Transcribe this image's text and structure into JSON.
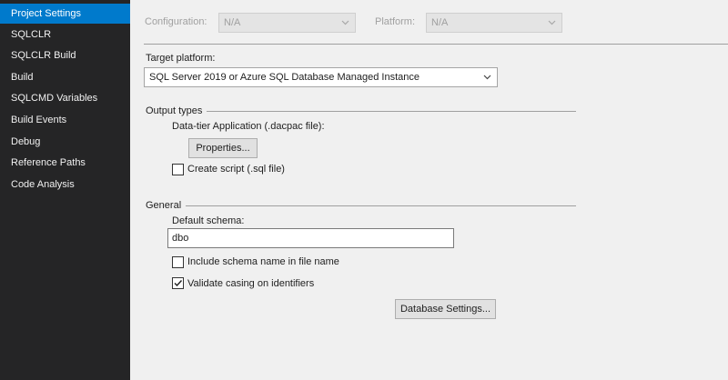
{
  "sidebar": {
    "items": [
      {
        "label": "Project Settings",
        "selected": true
      },
      {
        "label": "SQLCLR"
      },
      {
        "label": "SQLCLR Build"
      },
      {
        "label": "Build"
      },
      {
        "label": "SQLCMD Variables"
      },
      {
        "label": "Build Events"
      },
      {
        "label": "Debug"
      },
      {
        "label": "Reference Paths"
      },
      {
        "label": "Code Analysis"
      }
    ]
  },
  "toolbar": {
    "configuration_label": "Configuration:",
    "configuration_value": "N/A",
    "platform_label": "Platform:",
    "platform_value": "N/A"
  },
  "target_platform": {
    "label": "Target platform:",
    "value": "SQL Server 2019 or Azure SQL Database Managed Instance"
  },
  "output_types": {
    "header": "Output types",
    "dacpac_label": "Data-tier Application (.dacpac file):",
    "properties_button": "Properties...",
    "create_script_label": "Create script (.sql file)",
    "create_script_checked": false
  },
  "general": {
    "header": "General",
    "default_schema_label": "Default schema:",
    "default_schema_value": "dbo",
    "include_schema_label": "Include schema name in file name",
    "include_schema_checked": false,
    "validate_casing_label": "Validate casing on identifiers",
    "validate_casing_checked": true,
    "database_settings_button": "Database Settings..."
  },
  "colors": {
    "sidebar_bg": "#252526",
    "sidebar_selected": "#007acc",
    "main_bg": "#f0f0f0"
  }
}
